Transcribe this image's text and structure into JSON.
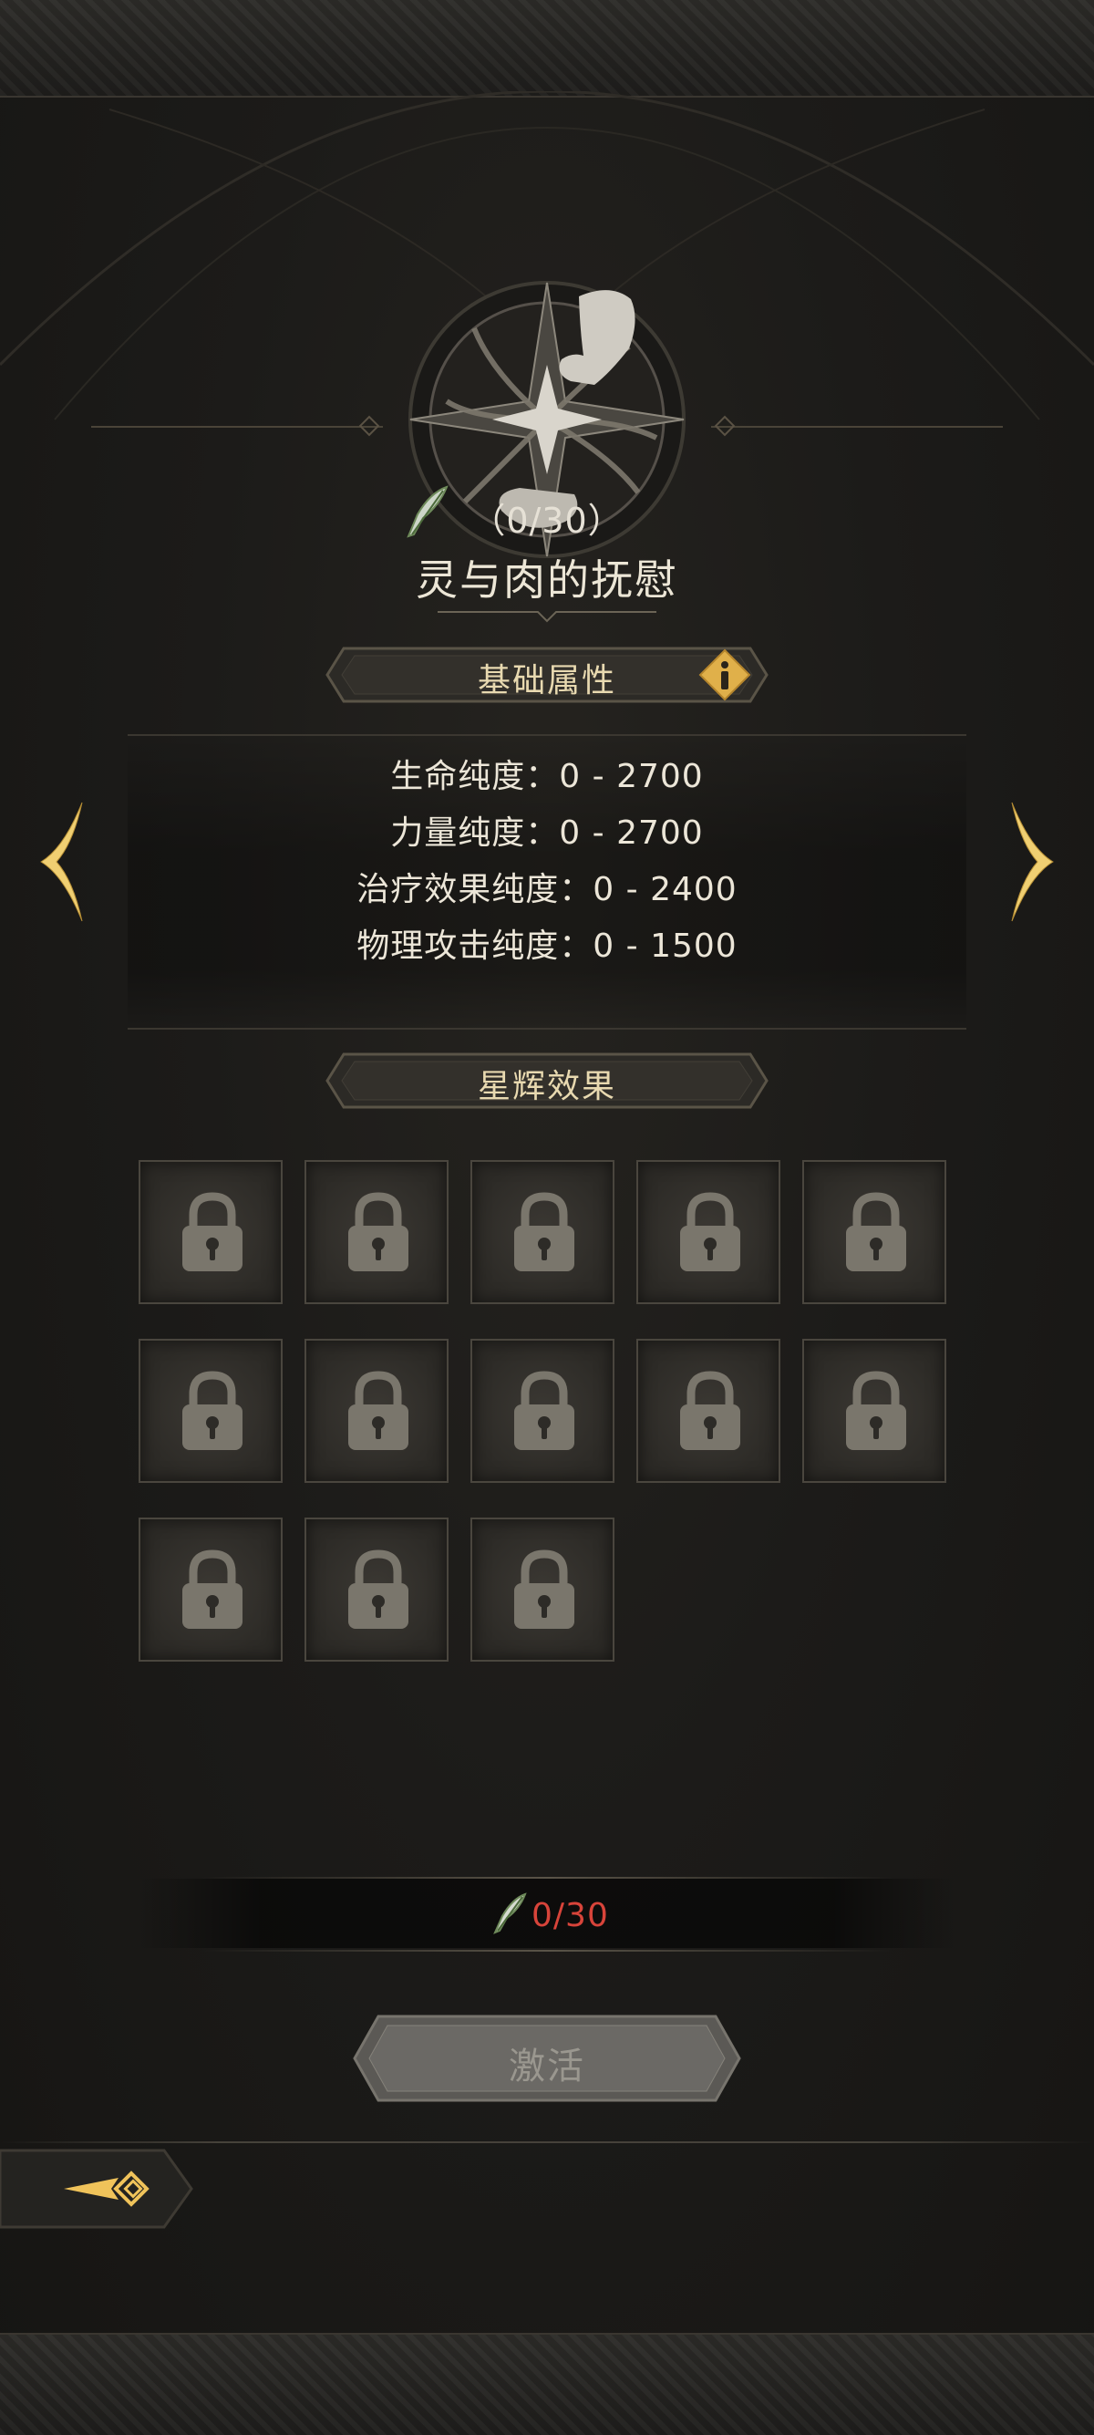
{
  "set": {
    "progress_text": "（0/30）",
    "name": "灵与肉的抚慰"
  },
  "base_attributes": {
    "header": "基础属性",
    "rows": [
      {
        "text": "生命纯度：0  -  2700"
      },
      {
        "text": "力量纯度：0  -  2700"
      },
      {
        "text": "治疗效果纯度：0  -  2400"
      },
      {
        "text": "物理攻击纯度：0  -  1500"
      }
    ]
  },
  "star_effects": {
    "header": "星辉效果",
    "slot_count": 13,
    "slot_state": "locked"
  },
  "cost": {
    "text": "0/30",
    "color": "#d8443a"
  },
  "actions": {
    "activate_label": "激活"
  },
  "icons": {
    "emblem": "star-hand-emblem-icon",
    "feather": "feather-icon",
    "info": "info-icon",
    "lock": "lock-icon",
    "prev": "chevron-left-icon",
    "next": "chevron-right-icon",
    "side_tab": "diamond-arrow-icon"
  },
  "colors": {
    "accent_gold": "#e0b04a",
    "text_light": "#ece6d8",
    "cost_red": "#d8443a"
  }
}
